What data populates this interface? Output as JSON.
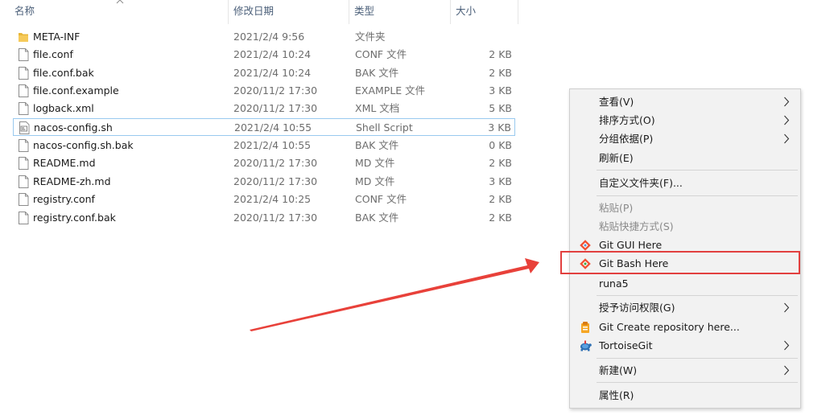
{
  "header": {
    "name": "名称",
    "date": "修改日期",
    "type": "类型",
    "size": "大小"
  },
  "files": [
    {
      "name": "META-INF",
      "date": "2021/2/4 9:56",
      "type": "文件夹",
      "size": "",
      "icon": "folder-icon"
    },
    {
      "name": "file.conf",
      "date": "2021/2/4 10:24",
      "type": "CONF 文件",
      "size": "2 KB",
      "icon": "file-icon"
    },
    {
      "name": "file.conf.bak",
      "date": "2021/2/4 10:24",
      "type": "BAK 文件",
      "size": "2 KB",
      "icon": "file-icon"
    },
    {
      "name": "file.conf.example",
      "date": "2020/11/2 17:30",
      "type": "EXAMPLE 文件",
      "size": "3 KB",
      "icon": "file-icon"
    },
    {
      "name": "logback.xml",
      "date": "2020/11/2 17:30",
      "type": "XML 文档",
      "size": "5 KB",
      "icon": "file-icon"
    },
    {
      "name": "nacos-config.sh",
      "date": "2021/2/4 10:55",
      "type": "Shell Script",
      "size": "3 KB",
      "icon": "shell-script-icon"
    },
    {
      "name": "nacos-config.sh.bak",
      "date": "2021/2/4 10:55",
      "type": "BAK 文件",
      "size": "0 KB",
      "icon": "file-icon"
    },
    {
      "name": "README.md",
      "date": "2020/11/2 17:30",
      "type": "MD 文件",
      "size": "2 KB",
      "icon": "file-icon"
    },
    {
      "name": "README-zh.md",
      "date": "2020/11/2 17:30",
      "type": "MD 文件",
      "size": "3 KB",
      "icon": "file-icon"
    },
    {
      "name": "registry.conf",
      "date": "2021/2/4 10:25",
      "type": "CONF 文件",
      "size": "2 KB",
      "icon": "file-icon"
    },
    {
      "name": "registry.conf.bak",
      "date": "2020/11/2 17:30",
      "type": "BAK 文件",
      "size": "2 KB",
      "icon": "file-icon"
    }
  ],
  "selected_file_index": 5,
  "context_menu": {
    "view": "查看(V)",
    "sort": "排序方式(O)",
    "group": "分组依据(P)",
    "refresh": "刷新(E)",
    "customize": "自定义文件夹(F)...",
    "paste": "粘贴(P)",
    "paste_shortcut": "粘贴快捷方式(S)",
    "git_gui": "Git GUI Here",
    "git_bash": "Git Bash Here",
    "runa5": "runa5",
    "grant_access": "授予访问权限(G)",
    "git_create": "Git Create repository here...",
    "tortoisegit": "TortoiseGit",
    "new": "新建(W)",
    "properties": "属性(R)"
  },
  "colors": {
    "highlight": "#e2403f",
    "arrow": "#e8413a",
    "selection_border": "#99c9ef",
    "folder": "#e8b73a",
    "git": "#f05133"
  }
}
